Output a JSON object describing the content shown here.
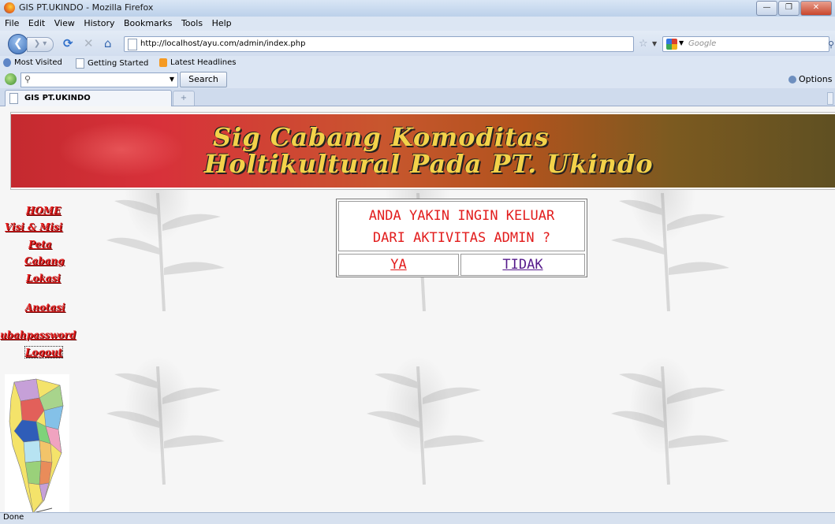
{
  "window": {
    "title": "GIS PT.UKINDO - Mozilla Firefox"
  },
  "menu": [
    "File",
    "Edit",
    "View",
    "History",
    "Bookmarks",
    "Tools",
    "Help"
  ],
  "nav": {
    "url": "http://localhost/ayu.com/admin/index.php",
    "search_engine_placeholder": "Google"
  },
  "bookmarks": [
    "Most Visited",
    "Getting Started",
    "Latest Headlines"
  ],
  "search_toolbar": {
    "button_label": "Search",
    "options_label": "Options"
  },
  "tab": {
    "title": "GIS PT.UKINDO"
  },
  "banner": {
    "line1": "Sig Cabang Komoditas",
    "line2": "Holtikultural Pada PT. Ukindo"
  },
  "sidebar": {
    "items": [
      {
        "label": "HOME"
      },
      {
        "label": "Visi & Misi"
      },
      {
        "label": "Peta"
      },
      {
        "label": "Cabang"
      },
      {
        "label": "Lokasi"
      },
      {
        "label": "Anotasi"
      },
      {
        "label": "ubahpassword"
      },
      {
        "label": "Logout"
      }
    ]
  },
  "dialog": {
    "message_line1": "ANDA YAKIN INGIN KELUAR",
    "message_line2": "DARI AKTIVITAS ADMIN ?",
    "yes_label": "YA",
    "no_label": "TIDAK"
  },
  "status": {
    "text": "Done"
  },
  "colors": {
    "link_red": "#e21d1d",
    "visited_purple": "#551a8b",
    "banner_text": "#f3d24a"
  }
}
